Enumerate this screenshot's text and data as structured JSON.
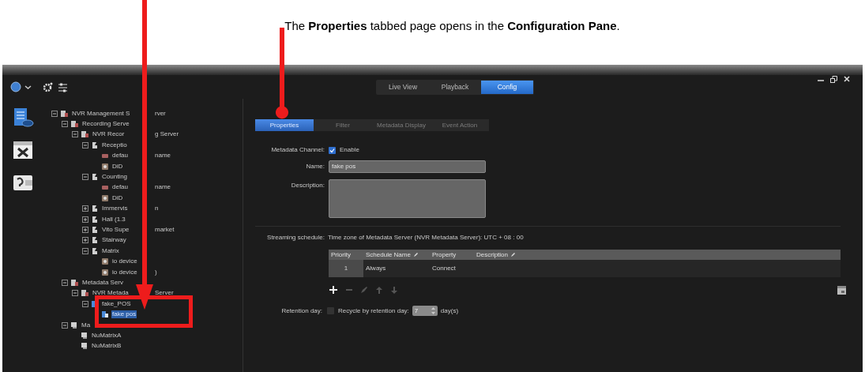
{
  "caption": "The **Properties** tabbed page opens in the **Configuration Pane**.",
  "mode_tabs": [
    {
      "label": "Live View",
      "selected": false
    },
    {
      "label": "Playback",
      "selected": false
    },
    {
      "label": "Config",
      "selected": true
    }
  ],
  "tree": [
    {
      "kind": "server",
      "label": "NVR Management S",
      "label_after": "rver",
      "expanded": true,
      "children": [
        {
          "kind": "server",
          "label": "Recording Serve",
          "expanded": true,
          "children": [
            {
              "kind": "server",
              "label": "NVR Recor",
              "label_after": "g Server",
              "expanded": true,
              "children": [
                {
                  "kind": "camera",
                  "label": "Receptio",
                  "expanded": true,
                  "children": [
                    {
                      "kind": "device",
                      "label": "defau",
                      "label_after": "name"
                    },
                    {
                      "kind": "io",
                      "label": "DiD"
                    }
                  ]
                },
                {
                  "kind": "camera",
                  "label": "Counting",
                  "expanded": true,
                  "children": [
                    {
                      "kind": "device",
                      "label": "defau",
                      "label_after": "name"
                    },
                    {
                      "kind": "io",
                      "label": "DiD"
                    }
                  ]
                },
                {
                  "kind": "camera",
                  "label": "Immervis",
                  "label_after": "n",
                  "expanded": false
                },
                {
                  "kind": "camera",
                  "label": "Hall (1.3",
                  "expanded": false
                },
                {
                  "kind": "camera",
                  "label": "Vito Supe",
                  "label_after": "market",
                  "expanded": false
                },
                {
                  "kind": "camera",
                  "label": "Stairway",
                  "expanded": false
                },
                {
                  "kind": "camera",
                  "label": "Matrix",
                  "expanded": true,
                  "children": [
                    {
                      "kind": "io",
                      "label": "io device"
                    },
                    {
                      "kind": "io",
                      "label": "io device",
                      "label_after": ")"
                    }
                  ]
                }
              ]
            }
          ]
        },
        {
          "kind": "server",
          "label": "Metadata Serv",
          "expanded": true,
          "children": [
            {
              "kind": "server",
              "label": "NVR Metada",
              "label_after": "Server",
              "expanded": true,
              "children": [
                {
                  "kind": "pos",
                  "label": "fake_POS",
                  "expanded": true,
                  "children": [
                    {
                      "kind": "pos",
                      "label": "fake pos",
                      "selected": true
                    }
                  ]
                }
              ]
            }
          ]
        },
        {
          "kind": "matrix",
          "label": "Ma",
          "expanded": true,
          "children": [
            {
              "kind": "matrix",
              "label": "NuMatrixA"
            },
            {
              "kind": "matrix",
              "label": "NuMatrixB"
            }
          ]
        }
      ]
    }
  ],
  "config_tabs": [
    {
      "label": "Properties",
      "selected": true
    },
    {
      "label": "Filter",
      "selected": false
    },
    {
      "label": "Metadata Display",
      "selected": false
    },
    {
      "label": "Event Action",
      "selected": false
    }
  ],
  "form": {
    "channel_label": "Metadata Channel:",
    "enable": {
      "label": "Enable",
      "checked": true
    },
    "name_label": "Name:",
    "name_value": "fake pos",
    "description_label": "Description:"
  },
  "schedule": {
    "label": "Streaming schedule:",
    "timezone": "Time zone of Metadata Server (NVR Metadata Server): UTC + 08 : 00",
    "columns": [
      {
        "label": "Priority",
        "editable": false
      },
      {
        "label": "Schedule Name",
        "editable": true
      },
      {
        "label": "Property",
        "editable": false
      },
      {
        "label": "Description",
        "editable": true
      }
    ],
    "rows": [
      [
        "1",
        "Always",
        "Connect",
        ""
      ]
    ]
  },
  "retention": {
    "label": "Retention day:",
    "recycle": {
      "label": "Recycle by retention day:",
      "checked": false
    },
    "days": "7",
    "unit": "day(s)"
  }
}
